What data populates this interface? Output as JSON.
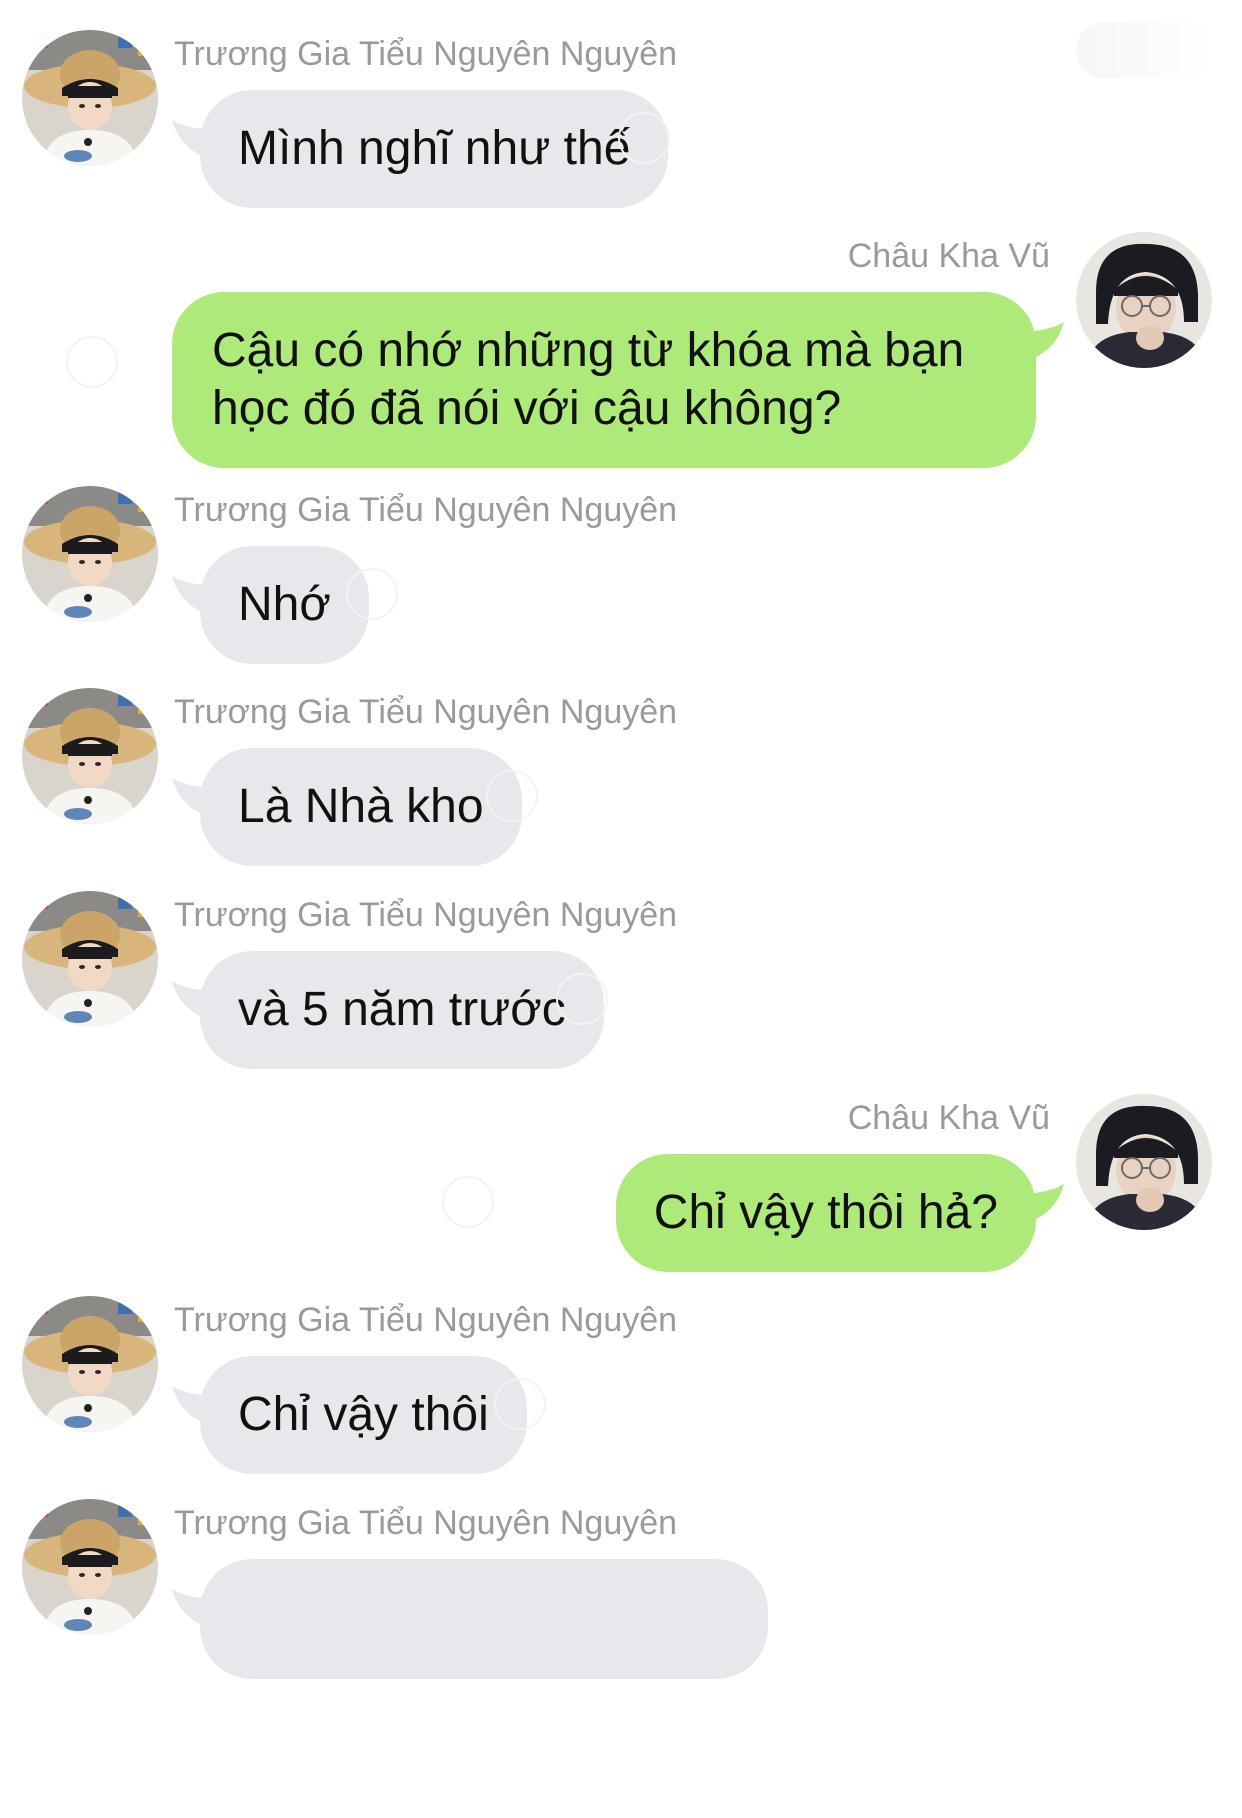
{
  "contacts": {
    "them": {
      "name": "Trương Gia Tiểu Nguyên Nguyên",
      "avatar_icon": "avatar-straw-hat-icon"
    },
    "me": {
      "name": "Châu Kha Vũ",
      "avatar_icon": "avatar-glasses-icon"
    }
  },
  "colors": {
    "incoming_bubble": "#e6e8ec",
    "outgoing_bubble": "#aeea7a",
    "sender_text": "#9a9a9a",
    "message_text": "#111111"
  },
  "messages": [
    {
      "direction": "incoming",
      "sender": "Trương Gia Tiểu Nguyên Nguyên",
      "text": "Mình nghĩ như thế"
    },
    {
      "direction": "outgoing",
      "sender": "Châu Kha Vũ",
      "text": "Cậu có nhớ những từ khóa mà bạn học đó đã nói với cậu không?"
    },
    {
      "direction": "incoming",
      "sender": "Trương Gia Tiểu Nguyên Nguyên",
      "text": "Nhớ"
    },
    {
      "direction": "incoming",
      "sender": "Trương Gia Tiểu Nguyên Nguyên",
      "text": "Là Nhà kho"
    },
    {
      "direction": "incoming",
      "sender": "Trương Gia Tiểu Nguyên Nguyên",
      "text": "và 5 năm trước"
    },
    {
      "direction": "outgoing",
      "sender": "Châu Kha Vũ",
      "text": "Chỉ vậy thôi hả?"
    },
    {
      "direction": "incoming",
      "sender": "Trương Gia Tiểu Nguyên Nguyên",
      "text": "Chỉ vậy thôi"
    },
    {
      "direction": "incoming",
      "sender": "Trương Gia Tiểu Nguyên Nguyên",
      "text": ""
    }
  ]
}
